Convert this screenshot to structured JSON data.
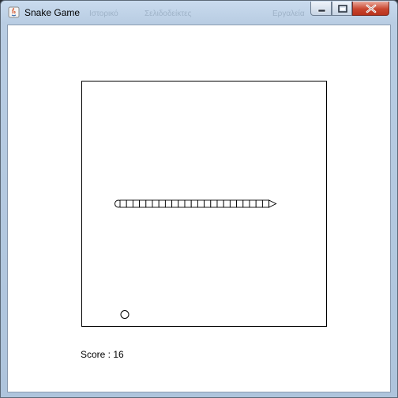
{
  "window": {
    "title": "Snake Game",
    "ghost_menu": [
      "Ιστορικό",
      "Σελιδοδείκτες",
      "Εργαλεία"
    ]
  },
  "controls": {
    "minimize_icon": "minimize-icon",
    "maximize_icon": "maximize-icon",
    "close_icon": "close-icon"
  },
  "game": {
    "score_label": "Score : 16",
    "snake_direction": "right",
    "snake_segment_count": 23,
    "stroke_color": "#000000",
    "background_color": "#ffffff"
  }
}
